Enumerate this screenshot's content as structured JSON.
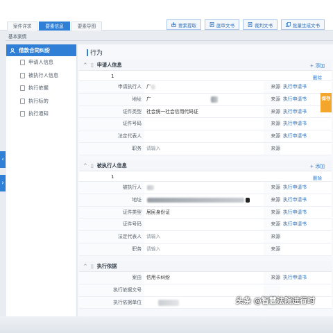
{
  "tabs": [
    {
      "label": "案件详求",
      "active": false
    },
    {
      "label": "要素信息",
      "active": true
    },
    {
      "label": "要素导图",
      "active": false
    }
  ],
  "actions": [
    {
      "label": "要素提取",
      "icon": "extract-icon"
    },
    {
      "label": "庭审文书",
      "icon": "document-icon"
    },
    {
      "label": "裁判文书",
      "icon": "document-icon"
    },
    {
      "label": "批量生成文书",
      "icon": "batch-icon"
    }
  ],
  "subtitle": "基本案情",
  "sidebar": {
    "head": "借款合同纠纷",
    "items": [
      "申请人信息",
      "被执行人信息",
      "执行依据",
      "执行标的",
      "执行通知"
    ]
  },
  "main_title": "行为",
  "side_tab": "保存",
  "sections": {
    "applicant": {
      "title": "申请人信息",
      "add": "+ 添加",
      "number": "1",
      "delete": "删除",
      "rows": [
        {
          "label": "申请执行人",
          "value": "广",
          "placeholder": false,
          "src": "来源",
          "doc": "执行申请书"
        },
        {
          "label": "地址",
          "value": "广",
          "placeholder": false,
          "src": "来源",
          "doc": "执行申请书"
        },
        {
          "label": "证件类型",
          "value": "社会统一社会信用代码证",
          "placeholder": false,
          "src": "来源",
          "doc": "执行申请书"
        },
        {
          "label": "证件号码",
          "value": "",
          "placeholder": false,
          "src": "来源",
          "doc": "执行申请书"
        },
        {
          "label": "法定代表人",
          "value": "",
          "placeholder": false,
          "src": "来源",
          "doc": "执行申请书"
        },
        {
          "label": "职务",
          "value": "请输入",
          "placeholder": true,
          "src": "来源",
          "doc": ""
        }
      ]
    },
    "respondent": {
      "title": "被执行人信息",
      "add": "+ 添加",
      "number": "1",
      "delete": "删除",
      "rows": [
        {
          "label": "被执行人",
          "value": "",
          "placeholder": false,
          "src": "来源",
          "doc": "执行申请书"
        },
        {
          "label": "地址",
          "value": "",
          "placeholder": false,
          "src": "来源",
          "doc": "执行申请书"
        },
        {
          "label": "证件类型",
          "value": "居民身份证",
          "placeholder": false,
          "src": "来源",
          "doc": "执行申请书"
        },
        {
          "label": "证件号码",
          "value": "",
          "placeholder": false,
          "src": "来源",
          "doc": "执行申请书"
        },
        {
          "label": "法定代表人",
          "value": "请输入",
          "placeholder": true,
          "src": "来源",
          "doc": ""
        },
        {
          "label": "职务",
          "value": "请输入",
          "placeholder": true,
          "src": "来源",
          "doc": ""
        }
      ]
    },
    "basis": {
      "title": "执行依据",
      "rows": [
        {
          "label": "案由",
          "value": "信用卡纠纷",
          "placeholder": false,
          "src": "来源",
          "doc": "执行申请书"
        },
        {
          "label": "执行依据文号",
          "value": "",
          "placeholder": false,
          "src": "",
          "doc": ""
        },
        {
          "label": "执行依据单位",
          "value": "",
          "placeholder": false,
          "src": "",
          "doc": ""
        }
      ]
    }
  },
  "watermark": "头条 @智慧法院进行时"
}
